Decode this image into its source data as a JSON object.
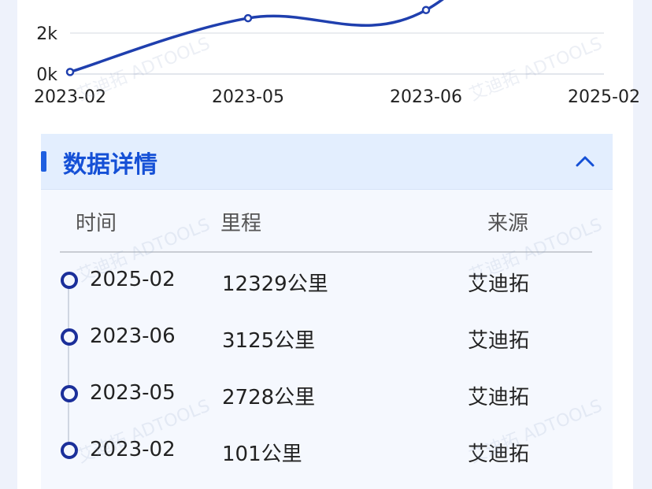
{
  "chart_data": {
    "type": "line",
    "x": [
      "2023-02",
      "2023-05",
      "2023-06",
      "2025-02"
    ],
    "values": [
      101,
      2728,
      3125,
      12329
    ],
    "y_tick_labels": [
      "0k",
      "2k"
    ],
    "y_tick_values": [
      0,
      2000
    ],
    "grid": true,
    "color": "#1f3fae"
  },
  "section": {
    "title": "数据详情",
    "collapse_icon": "chevron-up-icon"
  },
  "table": {
    "columns": [
      "时间",
      "里程",
      "来源"
    ],
    "rows": [
      {
        "time": "2025-02",
        "mileage": "12329公里",
        "source": "艾迪拓"
      },
      {
        "time": "2023-06",
        "mileage": "3125公里",
        "source": "艾迪拓"
      },
      {
        "time": "2023-05",
        "mileage": "2728公里",
        "source": "艾迪拓"
      },
      {
        "time": "2023-02",
        "mileage": "101公里",
        "source": "艾迪拓"
      }
    ]
  },
  "watermark": "艾迪拓 ADTOOLS"
}
